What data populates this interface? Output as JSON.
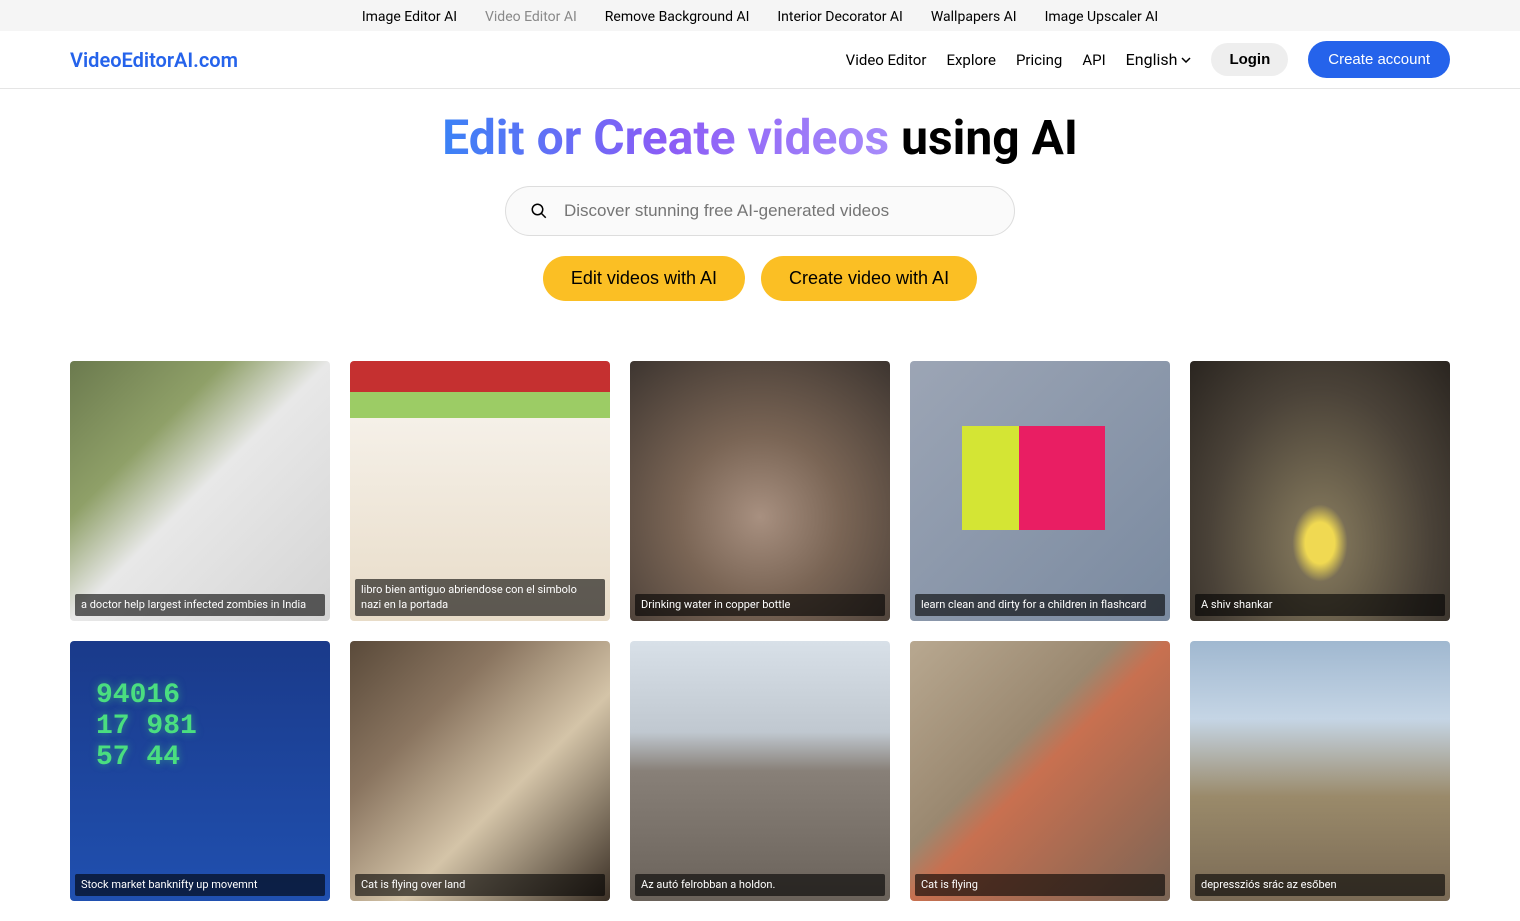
{
  "topbar": {
    "links": [
      {
        "label": "Image Editor AI",
        "active": false
      },
      {
        "label": "Video Editor AI",
        "active": true
      },
      {
        "label": "Remove Background AI",
        "active": false
      },
      {
        "label": "Interior Decorator AI",
        "active": false
      },
      {
        "label": "Wallpapers AI",
        "active": false
      },
      {
        "label": "Image Upscaler AI",
        "active": false
      }
    ]
  },
  "nav": {
    "logo": "VideoEditorAI.com",
    "links": [
      "Video Editor",
      "Explore",
      "Pricing",
      "API"
    ],
    "language": "English",
    "login": "Login",
    "create": "Create account"
  },
  "hero": {
    "gradient": "Edit or Create videos",
    "rest": " using AI",
    "search_placeholder": "Discover stunning free AI-generated videos",
    "cta1": "Edit videos with AI",
    "cta2": "Create video with AI"
  },
  "gallery": [
    {
      "caption": "a doctor help largest infected zombies in India"
    },
    {
      "caption": "libro bien antiguo abriendose con el simbolo nazi en la portada"
    },
    {
      "caption": "Drinking water in copper bottle"
    },
    {
      "caption": "learn clean and dirty for a children in flashcard"
    },
    {
      "caption": "A shiv shankar"
    },
    {
      "caption": "Stock market banknifty up movemnt"
    },
    {
      "caption": "Cat is flying over land"
    },
    {
      "caption": "Az autó felrobban a holdon."
    },
    {
      "caption": "Cat is flying"
    },
    {
      "caption": "depressziós srác az esőben"
    }
  ]
}
